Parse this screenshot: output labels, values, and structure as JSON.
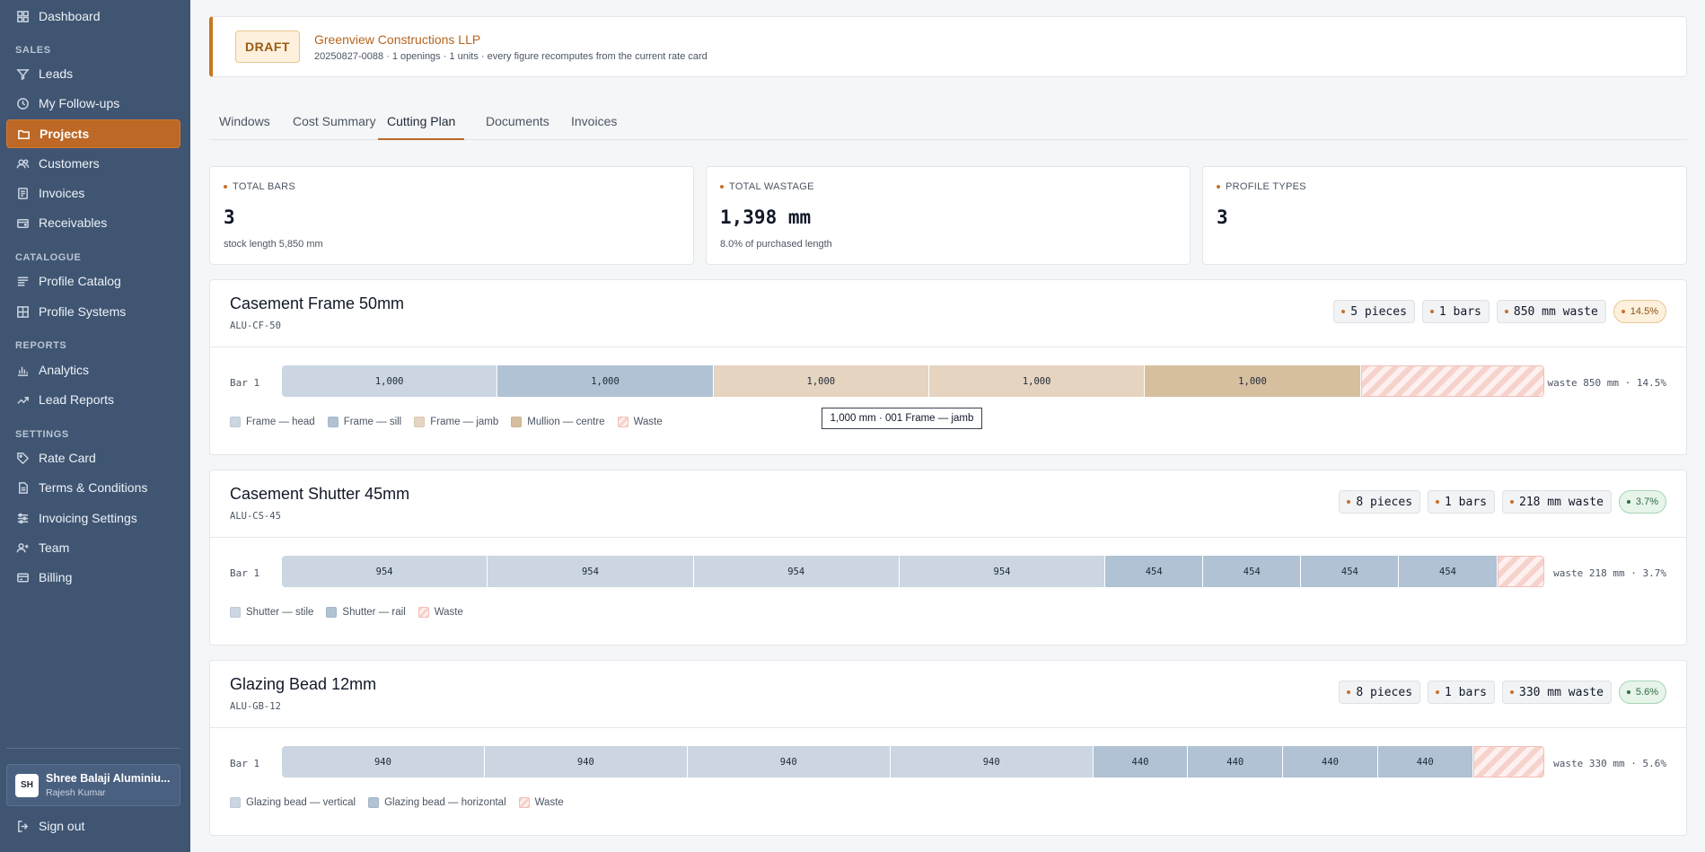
{
  "sidebar": {
    "top_item": {
      "label": "Dashboard",
      "icon": "dashboard-icon"
    },
    "sections": {
      "sales": "SALES",
      "catalogue": "CATALOGUE",
      "reports": "REPORTS",
      "settings": "SETTINGS"
    },
    "items": [
      {
        "label": "Leads",
        "icon": "funnel-icon"
      },
      {
        "label": "My Follow-ups",
        "icon": "clock-icon"
      },
      {
        "label": "Projects",
        "icon": "folder-icon",
        "active": true
      },
      {
        "label": "Customers",
        "icon": "users-icon"
      },
      {
        "label": "Invoices",
        "icon": "file-icon"
      },
      {
        "label": "Receivables",
        "icon": "wallet-icon"
      },
      {
        "label": "Profile Catalog",
        "icon": "list-icon"
      },
      {
        "label": "Profile Systems",
        "icon": "grid-icon"
      },
      {
        "label": "Analytics",
        "icon": "bar-chart-icon"
      },
      {
        "label": "Lead Reports",
        "icon": "trend-icon"
      },
      {
        "label": "Rate Card",
        "icon": "tag-icon"
      },
      {
        "label": "Terms & Conditions",
        "icon": "doc-icon"
      },
      {
        "label": "Invoicing Settings",
        "icon": "sliders-icon"
      },
      {
        "label": "Team",
        "icon": "user-plus-icon"
      },
      {
        "label": "Billing",
        "icon": "card-icon"
      }
    ],
    "org": {
      "avatar": "SH",
      "name": "Shree Balaji Aluminiu...",
      "user": "Rajesh Kumar"
    },
    "sign_out": "Sign out"
  },
  "header": {
    "status": "DRAFT",
    "client": "Greenview Constructions LLP",
    "meta": "20250827-0088 · 1 openings · 1 units · every figure recomputes from the current rate card"
  },
  "tabs": [
    "Windows",
    "Cost Summary",
    "Cutting Plan",
    "Documents",
    "Invoices"
  ],
  "active_tab": "Cutting Plan",
  "stats": [
    {
      "label": "TOTAL BARS",
      "value": "3",
      "sub": "stock length 5,850 mm"
    },
    {
      "label": "TOTAL WASTAGE",
      "value": "1,398 mm",
      "sub": "8.0% of purchased length"
    },
    {
      "label": "PROFILE TYPES",
      "value": "3",
      "sub": ""
    }
  ],
  "stock_length_mm": 5850,
  "profiles": [
    {
      "name": "Casement Frame 50mm",
      "code": "ALU-CF-50",
      "chips": {
        "pieces": "5 pieces",
        "bars": "1 bars",
        "waste": "850 mm waste",
        "pct": "14.5%",
        "pct_level": "warn"
      },
      "bar_label": "Bar 1",
      "cuts": [
        {
          "len": 1000,
          "label": "1,000",
          "color": "#cbd6e2"
        },
        {
          "len": 1000,
          "label": "1,000",
          "color": "#b0c2d4"
        },
        {
          "len": 1000,
          "label": "1,000",
          "color": "#e5d4bf"
        },
        {
          "len": 1000,
          "label": "1,000",
          "color": "#e5d4bf"
        },
        {
          "len": 1000,
          "label": "1,000",
          "color": "#d6bf9f"
        }
      ],
      "waste_len": 850,
      "waste_text": "waste 850 mm · 14.5%",
      "legend": [
        {
          "label": "Frame — head",
          "color": "#cbd6e2"
        },
        {
          "label": "Frame — sill",
          "color": "#b0c2d4"
        },
        {
          "label": "Frame — jamb",
          "color": "#e5d4bf"
        },
        {
          "label": "Mullion — centre",
          "color": "#d6bf9f"
        },
        {
          "label": "Waste",
          "waste": true
        }
      ]
    },
    {
      "name": "Casement Shutter 45mm",
      "code": "ALU-CS-45",
      "chips": {
        "pieces": "8 pieces",
        "bars": "1 bars",
        "waste": "218 mm waste",
        "pct": "3.7%",
        "pct_level": "ok"
      },
      "bar_label": "Bar 1",
      "cuts": [
        {
          "len": 954,
          "label": "954",
          "color": "#cbd6e2"
        },
        {
          "len": 954,
          "label": "954",
          "color": "#cbd6e2"
        },
        {
          "len": 954,
          "label": "954",
          "color": "#cbd6e2"
        },
        {
          "len": 954,
          "label": "954",
          "color": "#cbd6e2"
        },
        {
          "len": 454,
          "label": "454",
          "color": "#b0c2d4"
        },
        {
          "len": 454,
          "label": "454",
          "color": "#b0c2d4"
        },
        {
          "len": 454,
          "label": "454",
          "color": "#b0c2d4"
        },
        {
          "len": 454,
          "label": "454",
          "color": "#b0c2d4"
        }
      ],
      "waste_len": 218,
      "waste_text": "waste 218 mm · 3.7%",
      "legend": [
        {
          "label": "Shutter — stile",
          "color": "#cbd6e2"
        },
        {
          "label": "Shutter — rail",
          "color": "#b0c2d4"
        },
        {
          "label": "Waste",
          "waste": true
        }
      ]
    },
    {
      "name": "Glazing Bead 12mm",
      "code": "ALU-GB-12",
      "chips": {
        "pieces": "8 pieces",
        "bars": "1 bars",
        "waste": "330 mm waste",
        "pct": "5.6%",
        "pct_level": "ok"
      },
      "bar_label": "Bar 1",
      "cuts": [
        {
          "len": 940,
          "label": "940",
          "color": "#cbd6e2"
        },
        {
          "len": 940,
          "label": "940",
          "color": "#cbd6e2"
        },
        {
          "len": 940,
          "label": "940",
          "color": "#cbd6e2"
        },
        {
          "len": 940,
          "label": "940",
          "color": "#cbd6e2"
        },
        {
          "len": 440,
          "label": "440",
          "color": "#b0c2d4"
        },
        {
          "len": 440,
          "label": "440",
          "color": "#b0c2d4"
        },
        {
          "len": 440,
          "label": "440",
          "color": "#b0c2d4"
        },
        {
          "len": 440,
          "label": "440",
          "color": "#b0c2d4"
        }
      ],
      "waste_len": 330,
      "waste_text": "waste 330 mm · 5.6%",
      "legend": [
        {
          "label": "Glazing bead — vertical",
          "color": "#cbd6e2"
        },
        {
          "label": "Glazing bead — horizontal",
          "color": "#b0c2d4"
        },
        {
          "label": "Waste",
          "waste": true
        }
      ]
    }
  ],
  "tooltip": "1,000 mm · 001 Frame — jamb"
}
